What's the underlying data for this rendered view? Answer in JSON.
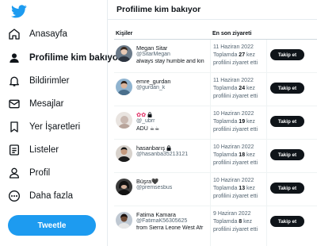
{
  "sidebar": {
    "logo": "twitter-bird-icon",
    "brand_color": "#1d9bf0",
    "items": [
      {
        "label": "Anasayfa",
        "icon": "home-icon",
        "active": false
      },
      {
        "label": "Profilime kim bakıyor",
        "icon": "person-icon",
        "active": true
      },
      {
        "label": "Bildirimler",
        "icon": "bell-icon",
        "active": false
      },
      {
        "label": "Mesajlar",
        "icon": "mail-icon",
        "active": false
      },
      {
        "label": "Yer İşaretleri",
        "icon": "bookmark-icon",
        "active": false
      },
      {
        "label": "Listeler",
        "icon": "list-icon",
        "active": false
      },
      {
        "label": "Profil",
        "icon": "profile-icon",
        "active": false
      },
      {
        "label": "Daha fazla",
        "icon": "more-icon",
        "active": false
      }
    ],
    "tweet_button": "Tweetle"
  },
  "main": {
    "title": "Profilime kim bakıyor",
    "columns": [
      "Kişiler",
      "En son ziyareti"
    ],
    "rows": [
      {
        "name": "Megan Sitar",
        "handle": "@SitarMegan",
        "bio": "always stay humble and kin",
        "date": "11 Haziran 2022",
        "pre": "Toplamda ",
        "count": "27",
        "post": " kez",
        "line3": "profilini ziyaret etti",
        "follow": "Takip et",
        "locked": false
      },
      {
        "name": "emre_gurdan",
        "handle": "@gurdan_k",
        "bio": "",
        "date": "11 Haziran 2022",
        "pre": "Toplamda ",
        "count": "24",
        "post": " kez",
        "line3": "profilini ziyaret etti",
        "follow": "Takip et",
        "locked": false
      },
      {
        "name": "✿✿",
        "handle": "@_ubrr",
        "bio": "ADÜ ☕☕",
        "date": "10 Haziran 2022",
        "pre": "Toplamda ",
        "count": "19",
        "post": " kez",
        "line3": "profilini ziyaret etti",
        "follow": "Takip et",
        "locked": true
      },
      {
        "name": "hasanbarış",
        "handle": "@hasanba35213121",
        "bio": "",
        "date": "10 Haziran 2022",
        "pre": "Toplamda ",
        "count": "18",
        "post": " kez",
        "line3": "profilini ziyaret etti",
        "follow": "Takip et",
        "locked": true
      },
      {
        "name": "Büşra🖤",
        "handle": "@premsesbus",
        "bio": "",
        "date": "10 Haziran 2022",
        "pre": "Toplamda ",
        "count": "13",
        "post": " kez",
        "line3": "profilini ziyaret etti",
        "follow": "Takip et",
        "locked": false
      },
      {
        "name": "Fatima Kamara",
        "handle": "@FatimaK56305625",
        "bio": "from Sierra Leone West Afr",
        "date": "9 Haziran 2022",
        "pre": "Toplamda ",
        "count": "8",
        "post": " kez",
        "line3": "profilini ziyaret etti",
        "follow": "Takip et",
        "locked": false
      }
    ]
  }
}
